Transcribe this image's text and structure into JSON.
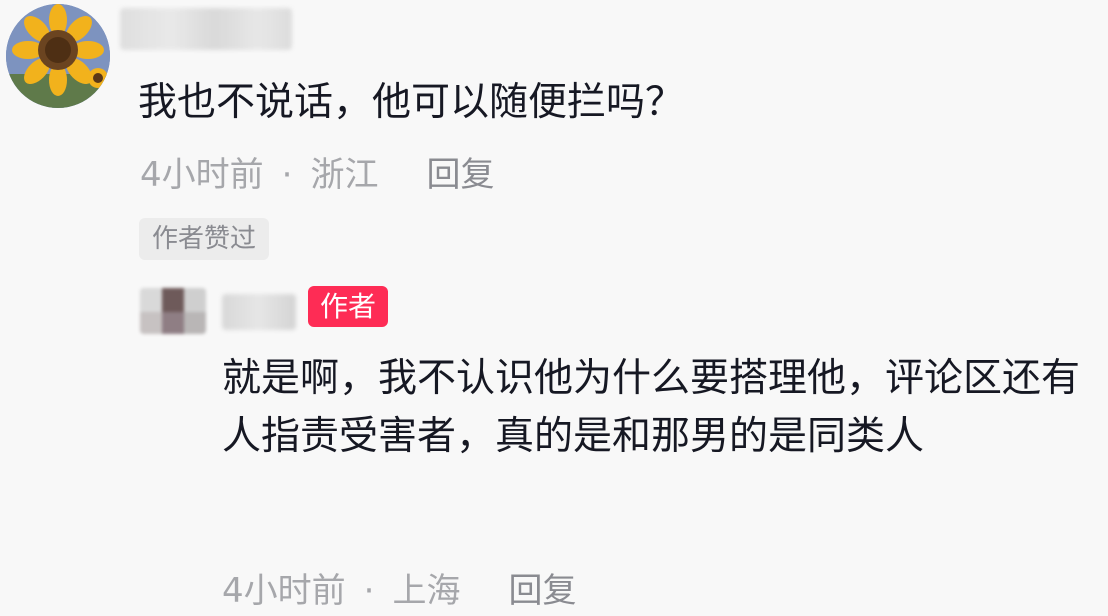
{
  "comment": {
    "avatar_icon": "sunflower-avatar",
    "text": "我也不说话，他可以随便拦吗？",
    "time": "4小时前",
    "separator": "·",
    "location": "浙江",
    "reply_label": "回复",
    "liked_by_author": "作者赞过"
  },
  "reply": {
    "author_badge": "作者",
    "text": "就是啊，我不认识他为什么要搭理他，评论区还有人指责受害者，真的是和那男的是同类人",
    "time": "4小时前",
    "separator": "·",
    "location": "上海",
    "reply_label": "回复"
  },
  "colors": {
    "background": "#f8f8f8",
    "text": "#161823",
    "meta": "#a6a7ab",
    "author_badge": "#fe2c55"
  }
}
